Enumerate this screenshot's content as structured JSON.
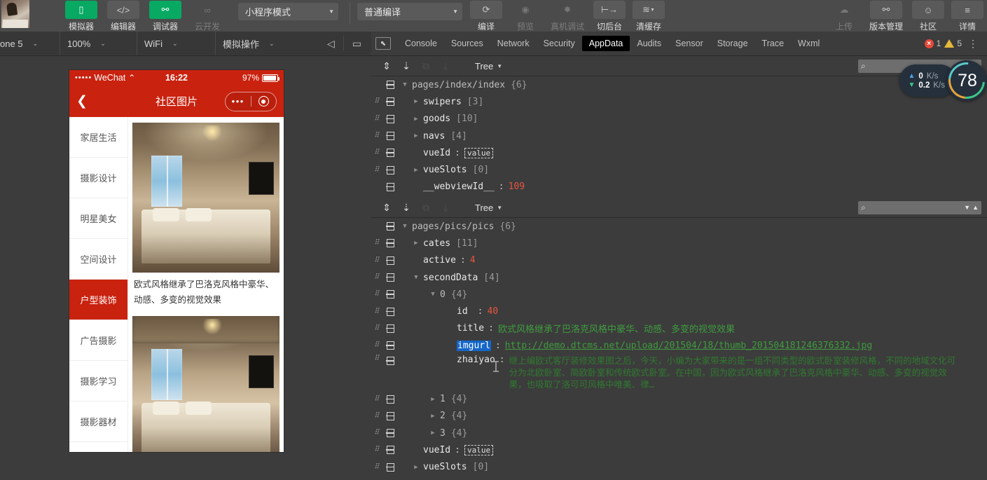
{
  "toolbar": {
    "items": [
      {
        "label": "模拟器",
        "icon": "phone-icon",
        "glyph": "▯",
        "state": "green"
      },
      {
        "label": "编辑器",
        "icon": "code-icon",
        "glyph": "</>",
        "state": "grey"
      },
      {
        "label": "调试器",
        "icon": "debugger-icon",
        "glyph": "⚯",
        "state": "green"
      },
      {
        "label": "云开发",
        "icon": "cloud-dev-icon",
        "glyph": "∞",
        "state": "disabled"
      }
    ],
    "mode_select": "小程序模式",
    "compile_select": "普通编译",
    "actions": [
      {
        "label": "编译",
        "icon": "refresh-icon",
        "glyph": "⟳",
        "state": "grey"
      },
      {
        "label": "预览",
        "icon": "eye-icon",
        "glyph": "◉",
        "state": "disabled"
      },
      {
        "label": "真机调试",
        "icon": "bug-icon",
        "glyph": "✸",
        "state": "disabled"
      },
      {
        "label": "切后台",
        "icon": "background-icon",
        "glyph": "⊢→",
        "state": "grey"
      },
      {
        "label": "清缓存",
        "icon": "layers-icon",
        "glyph": "≋",
        "state": "grey"
      }
    ],
    "right_actions": [
      {
        "label": "上传",
        "icon": "upload-cloud-icon",
        "glyph": "☁",
        "state": "disabled"
      },
      {
        "label": "版本管理",
        "icon": "branch-icon",
        "glyph": "⚯",
        "state": "grey"
      },
      {
        "label": "社区",
        "icon": "chat-icon",
        "glyph": "☺",
        "state": "grey"
      },
      {
        "label": "详情",
        "icon": "menu-icon",
        "glyph": "≡",
        "state": "grey"
      }
    ]
  },
  "simbar": {
    "device": "one 5",
    "zoom": "100%",
    "network": "WiFi",
    "action": "模拟操作",
    "icons": [
      {
        "name": "volume-icon",
        "glyph": "◁"
      },
      {
        "name": "screen-icon",
        "glyph": "▭"
      }
    ]
  },
  "devtools": {
    "tabs": [
      {
        "label": "Console",
        "active": false
      },
      {
        "label": "Sources",
        "active": false
      },
      {
        "label": "Network",
        "active": false
      },
      {
        "label": "Security",
        "active": false
      },
      {
        "label": "AppData",
        "active": true
      },
      {
        "label": "Audits",
        "active": false
      },
      {
        "label": "Sensor",
        "active": false
      },
      {
        "label": "Storage",
        "active": false
      },
      {
        "label": "Trace",
        "active": false
      },
      {
        "label": "Wxml",
        "active": false
      }
    ],
    "error_count": "1",
    "warning_count": "5",
    "inspect_icon": "inspect-cursor-icon",
    "kebab_icon": "more-options-icon"
  },
  "panel1": {
    "view_mode": "Tree",
    "search_placeholder": "",
    "rows": [
      {
        "indent": 0,
        "gutter": false,
        "twisty": "down",
        "key": "pages/index/index",
        "keyClass": "path",
        "count": "{6}"
      },
      {
        "indent": 1,
        "gutter": true,
        "twisty": "right",
        "key": "swipers",
        "count": "[3]"
      },
      {
        "indent": 1,
        "gutter": true,
        "twisty": "right",
        "key": "goods",
        "count": "[10]"
      },
      {
        "indent": 1,
        "gutter": true,
        "twisty": "right",
        "key": "navs",
        "count": "[4]"
      },
      {
        "indent": 1,
        "gutter": true,
        "twisty": "none",
        "key": "vueId",
        "valueType": "box",
        "value": "value"
      },
      {
        "indent": 1,
        "gutter": true,
        "twisty": "right",
        "key": "vueSlots",
        "count": "[0]"
      },
      {
        "indent": 1,
        "gutter": false,
        "twisty": "none",
        "key": "__webviewId__",
        "valueType": "num",
        "value": "109"
      }
    ]
  },
  "panel2": {
    "view_mode": "Tree",
    "search_placeholder": "",
    "rows": [
      {
        "indent": 0,
        "gutter": false,
        "twisty": "down",
        "key": "pages/pics/pics",
        "keyClass": "path",
        "count": "{6}"
      },
      {
        "indent": 1,
        "gutter": true,
        "twisty": "right",
        "key": "cates",
        "count": "[11]"
      },
      {
        "indent": 1,
        "gutter": true,
        "twisty": "none",
        "key": "active",
        "valueType": "num",
        "value": "4"
      },
      {
        "indent": 1,
        "gutter": true,
        "twisty": "down",
        "key": "secondData",
        "count": "[4]"
      },
      {
        "indent": 2,
        "gutter": true,
        "twisty": "down",
        "key": "0",
        "keyClass": "path",
        "count": "{4}"
      },
      {
        "indent": 3,
        "gutter": true,
        "twisty": "none",
        "key": "id",
        "valueType": "num",
        "value": "40"
      },
      {
        "indent": 3,
        "gutter": true,
        "twisty": "none",
        "key": "title",
        "valueType": "str",
        "value": "欧式风格继承了巴洛克风格中豪华、动感、多变的视觉效果"
      },
      {
        "indent": 3,
        "gutter": true,
        "twisty": "none",
        "key": "imgurl",
        "selected": true,
        "valueType": "link",
        "value": "http://demo.dtcms.net/upload/201504/18/thumb_201504181246376332.jpg"
      },
      {
        "indent": 3,
        "gutter": true,
        "twisty": "none",
        "key": "zhaiyao",
        "valueType": "wrap",
        "value": "继上编欧式客厅装修效果图之后，今天，小编为大家带来的是一组不同类型的欧式卧室装修风格，不同的地域文化可分为北欧卧室、简欧卧室和传统欧式卧室。在中国，因为欧式风格继承了巴洛克风格中豪华、动感、多变的视觉效果，也吸取了洛可可风格中唯美、律…"
      },
      {
        "indent": 2,
        "gutter": true,
        "twisty": "right",
        "key": "1",
        "keyClass": "path",
        "count": "{4}"
      },
      {
        "indent": 2,
        "gutter": true,
        "twisty": "right",
        "key": "2",
        "keyClass": "path",
        "count": "{4}"
      },
      {
        "indent": 2,
        "gutter": true,
        "twisty": "right",
        "key": "3",
        "keyClass": "path",
        "count": "{4}"
      },
      {
        "indent": 1,
        "gutter": true,
        "twisty": "none",
        "key": "vueId",
        "valueType": "box",
        "value": "value"
      },
      {
        "indent": 1,
        "gutter": true,
        "twisty": "right",
        "key": "vueSlots",
        "count": "[0]"
      }
    ]
  },
  "phone": {
    "status": {
      "signal_dots": "•••••",
      "carrier": "WeChat",
      "wifi_icon": "wifi-icon",
      "time": "16:22",
      "battery_pct": "97%",
      "battery_level": 97
    },
    "nav": {
      "back_icon": "back-chevron-icon",
      "title": "社区图片",
      "dots": "•••",
      "target_icon": "target-icon"
    },
    "cates": [
      {
        "label": "家居生活",
        "active": false
      },
      {
        "label": "摄影设计",
        "active": false
      },
      {
        "label": "明星美女",
        "active": false
      },
      {
        "label": "空间设计",
        "active": false
      },
      {
        "label": "户型装饰",
        "active": true
      },
      {
        "label": "广告摄影",
        "active": false
      },
      {
        "label": "摄影学习",
        "active": false
      },
      {
        "label": "摄影器材",
        "active": false
      }
    ],
    "cards": [
      {
        "caption": "欧式风格继承了巴洛克风格中豪华、动感、多变的视觉效果"
      },
      {
        "caption": ""
      }
    ],
    "accent_color": "#c9220f"
  },
  "net_widget": {
    "upload": {
      "value": "0",
      "unit": "K/s",
      "icon": "arrow-up-icon"
    },
    "download": {
      "value": "0.2",
      "unit": "K/s",
      "icon": "arrow-down-icon"
    },
    "gauge_value": "78"
  }
}
